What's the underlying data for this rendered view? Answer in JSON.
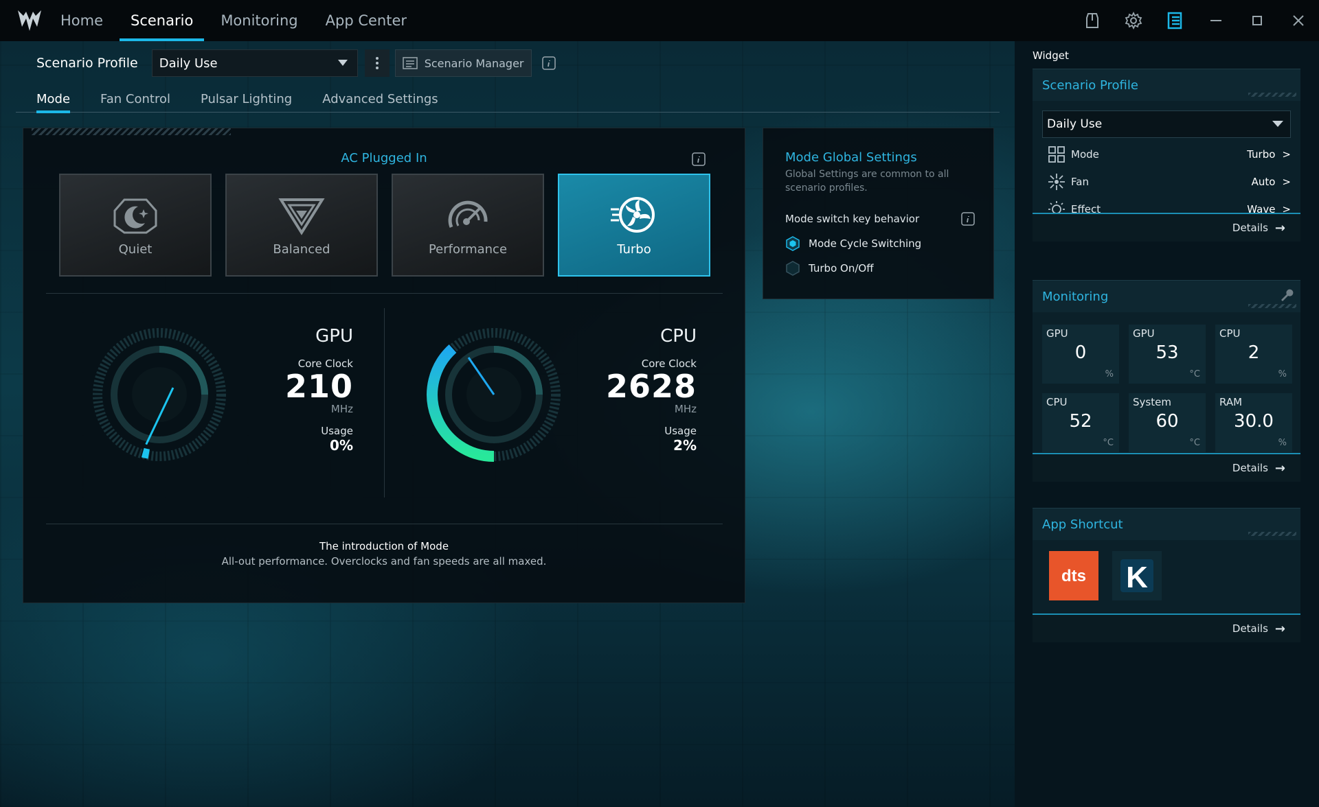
{
  "nav": {
    "tabs": [
      {
        "label": "Home"
      },
      {
        "label": "Scenario"
      },
      {
        "label": "Monitoring"
      },
      {
        "label": "App Center"
      }
    ],
    "active": "Scenario"
  },
  "profile": {
    "label": "Scenario Profile",
    "selected": "Daily Use",
    "manager_label": "Scenario Manager"
  },
  "subtabs": [
    {
      "label": "Mode"
    },
    {
      "label": "Fan Control"
    },
    {
      "label": "Pulsar Lighting"
    },
    {
      "label": "Advanced Settings"
    }
  ],
  "mode": {
    "power_state": "AC Plugged In",
    "cards": [
      {
        "label": "Quiet",
        "icon": "quiet-moon-icon"
      },
      {
        "label": "Balanced",
        "icon": "balanced-chevron-icon"
      },
      {
        "label": "Performance",
        "icon": "performance-gauge-icon"
      },
      {
        "label": "Turbo",
        "icon": "turbo-fan-icon"
      }
    ],
    "active": "Turbo",
    "gpu": {
      "title": "GPU",
      "clock_label": "Core Clock",
      "clock": "210",
      "clock_unit": "MHz",
      "usage_label": "Usage",
      "usage": "0%",
      "usage_value": 0
    },
    "cpu": {
      "title": "CPU",
      "clock_label": "Core Clock",
      "clock": "2628",
      "clock_unit": "MHz",
      "usage_label": "Usage",
      "usage": "2%",
      "usage_value": 2
    },
    "intro_title": "The introduction of Mode",
    "intro_text": "All-out performance. Overclocks and fan speeds are all maxed."
  },
  "global_settings": {
    "title": "Mode Global Settings",
    "subtitle": "Global Settings are common to all scenario profiles.",
    "key_behavior_label": "Mode switch key behavior",
    "options": [
      {
        "label": "Mode Cycle Switching",
        "selected": true
      },
      {
        "label": "Turbo On/Off",
        "selected": false
      }
    ]
  },
  "widget": {
    "title": "Widget",
    "scenario": {
      "title": "Scenario Profile",
      "selected": "Daily Use",
      "rows": [
        {
          "label": "Mode",
          "value": "Turbo",
          "icon": "grid-icon"
        },
        {
          "label": "Fan",
          "value": "Auto",
          "icon": "fan-icon"
        },
        {
          "label": "Effect",
          "value": "Wave",
          "icon": "sun-effect-icon"
        }
      ],
      "details": "Details"
    },
    "monitoring": {
      "title": "Monitoring",
      "cells": [
        {
          "label": "GPU",
          "value": "0",
          "unit": "%"
        },
        {
          "label": "GPU",
          "value": "53",
          "unit": "°C"
        },
        {
          "label": "CPU",
          "value": "2",
          "unit": "%"
        },
        {
          "label": "CPU",
          "value": "52",
          "unit": "°C"
        },
        {
          "label": "System",
          "value": "60",
          "unit": "°C"
        },
        {
          "label": "RAM",
          "value": "30.0",
          "unit": "%"
        }
      ],
      "details": "Details"
    },
    "shortcuts": {
      "title": "App Shortcut",
      "apps": [
        {
          "name": "dts",
          "color": "#e8552a"
        },
        {
          "name": "K",
          "color": "#0f2a34"
        }
      ],
      "details": "Details"
    }
  },
  "colors": {
    "accent": "#1cb8e8",
    "accent_text": "#2fb5e0",
    "turbo_card": "#1a8aa8"
  }
}
